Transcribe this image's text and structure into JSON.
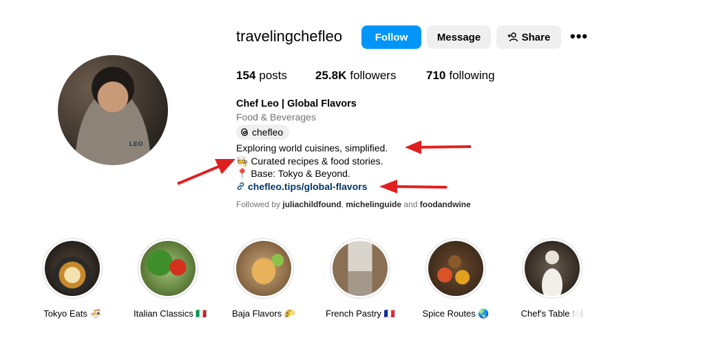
{
  "profile": {
    "username": "travelingchefleo",
    "avatar_badge": "LEO"
  },
  "actions": {
    "follow": "Follow",
    "message": "Message",
    "share": "Share",
    "more": "•••"
  },
  "stats": {
    "posts_count": "154",
    "posts_label": "posts",
    "followers_count": "25.8K",
    "followers_label": "followers",
    "following_count": "710",
    "following_label": "following"
  },
  "bio": {
    "name": "Chef Leo | Global Flavors",
    "category": "Food & Beverages",
    "threads_handle": "chefleo",
    "line1": "Exploring world cuisines, simplified.",
    "line2": "🧑‍🍳 Curated recipes & food stories.",
    "line3": "📍 Base: Tokyo & Beyond.",
    "link": "chefleo.tips/global-flavors",
    "followed_prefix": "Followed by ",
    "followed_user1": "juliachildfound",
    "followed_sep": ", ",
    "followed_user2": "michelinguide",
    "followed_and": " and ",
    "followed_user3": "foodandwine"
  },
  "highlights": [
    {
      "label": "Tokyo Eats 🍜",
      "icon": "ramen-bowl"
    },
    {
      "label": "Italian Classics 🇮🇹",
      "icon": "tomato-basil"
    },
    {
      "label": "Baja Flavors 🌮",
      "icon": "tacos"
    },
    {
      "label": "French Pastry 🇫🇷",
      "icon": "eiffel-street"
    },
    {
      "label": "Spice Routes 🌏",
      "icon": "spices"
    },
    {
      "label": "Chef's Table 🍽️",
      "icon": "chef-table"
    }
  ],
  "colors": {
    "follow_button": "#0095f6",
    "secondary_button": "#efefef",
    "link": "#00376b",
    "annotation_arrow": "#e02020"
  }
}
